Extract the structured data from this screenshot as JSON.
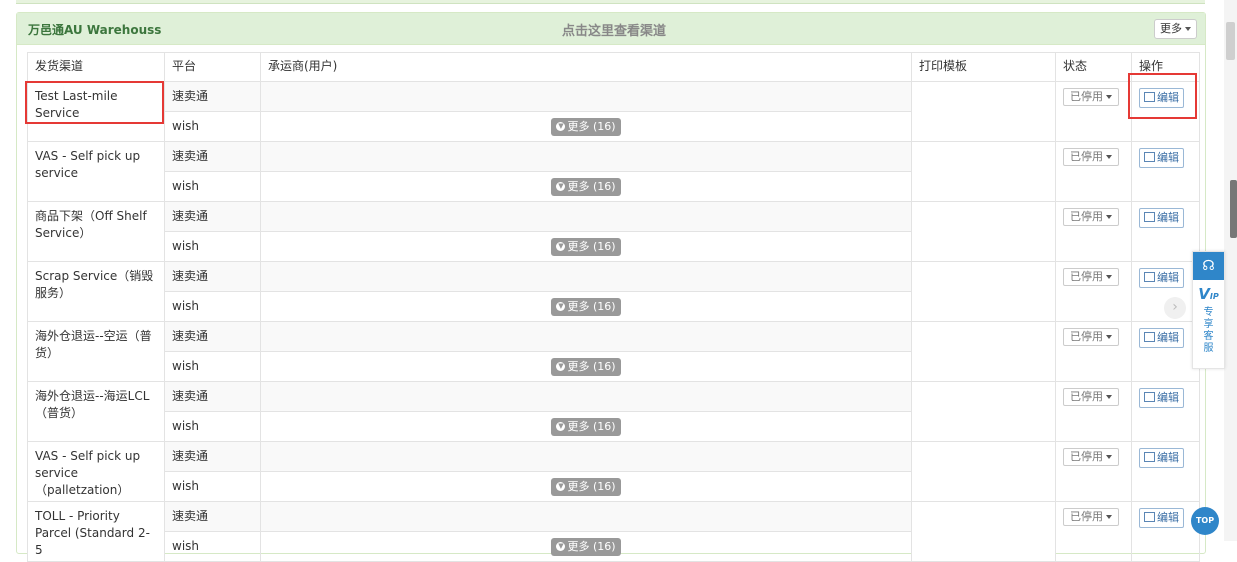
{
  "panel": {
    "warehouse_name": "万邑通AU Warehouss",
    "channel_link": "点击这里查看渠道",
    "more_button": "更多"
  },
  "table": {
    "headers": [
      "发货渠道",
      "平台",
      "承运商(用户)",
      "打印模板",
      "状态",
      "操作"
    ],
    "platforms": [
      "速卖通",
      "wish"
    ],
    "expand_label": "更多 (16)",
    "status_label": "已停用",
    "edit_label": "编辑",
    "rows": [
      {
        "channel": "Test Last-mile Service"
      },
      {
        "channel": "VAS - Self pick up service"
      },
      {
        "channel": "商品下架（Off Shelf Service）"
      },
      {
        "channel": "Scrap Service（销毁服务）"
      },
      {
        "channel": "海外仓退运--空运（普货）"
      },
      {
        "channel": "海外仓退运--海运LCL（普货）"
      },
      {
        "channel": "VAS - Self pick up service（palletzation）"
      },
      {
        "channel": "TOLL - Priority Parcel (Standard 2-5"
      }
    ]
  },
  "side_widget": {
    "vip_letter": "V",
    "vip_sub": "IP",
    "text": "专享客服",
    "top_label": "TOP",
    "headset_icon": "headset-icon",
    "arrow_icon": "chevron-right-icon"
  },
  "colors": {
    "panel_header_bg": "#dff0d8",
    "warehouse_text": "#3c763d",
    "highlight": "#e53935",
    "accent_blue": "#2f86c9"
  }
}
